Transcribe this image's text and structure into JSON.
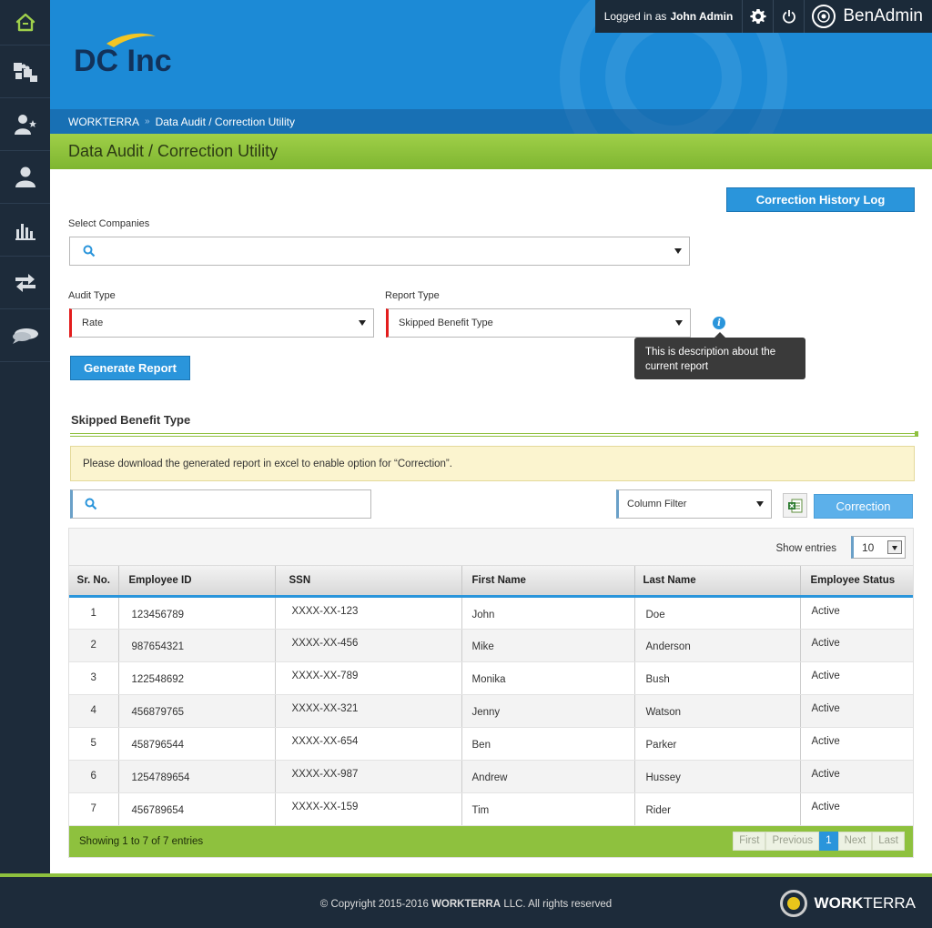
{
  "header": {
    "logo_text": "DC Inc",
    "logged_in_prefix": "Logged in as",
    "user_name": "John Admin",
    "brand": "BenAdmin",
    "breadcrumb": [
      "WORKTERRA",
      "Data Audit / Correction Utility"
    ]
  },
  "page": {
    "title": "Data Audit / Correction Utility"
  },
  "form": {
    "history_button": "Correction History Log",
    "select_companies_label": "Select Companies",
    "select_companies_value": "",
    "audit_type_label": "Audit Type",
    "audit_type_value": "Rate",
    "report_type_label": "Report Type",
    "report_type_value": "Skipped Benefit Type",
    "tooltip": "This is description about the current report",
    "generate_button": "Generate Report"
  },
  "report": {
    "section_title": "Skipped Benefit Type",
    "notice": "Please download the generated report in excel to enable option for “Correction”.",
    "search_value": "",
    "column_filter": "Column Filter",
    "correction_button": "Correction",
    "show_entries_label": "Show entries",
    "entries_value": "10",
    "columns": [
      "Sr. No.",
      "Employee ID",
      "SSN",
      "First Name",
      "Last Name",
      "Employee Status"
    ],
    "rows": [
      [
        "1",
        "123456789",
        "XXXX-XX-123",
        "John",
        "Doe",
        "Active"
      ],
      [
        "2",
        "987654321",
        "XXXX-XX-456",
        "Mike",
        "Anderson",
        "Active"
      ],
      [
        "3",
        "122548692",
        "XXXX-XX-789",
        "Monika",
        "Bush",
        "Active"
      ],
      [
        "4",
        "456879765",
        "XXXX-XX-321",
        "Jenny",
        "Watson",
        "Active"
      ],
      [
        "5",
        "458796544",
        "XXXX-XX-654",
        "Ben",
        "Parker",
        "Active"
      ],
      [
        "6",
        "1254789654",
        "XXXX-XX-987",
        "Andrew",
        "Hussey",
        "Active"
      ],
      [
        "7",
        "456789654",
        "XXXX-XX-159",
        "Tim",
        "Rider",
        "Active"
      ]
    ],
    "footer_info": "Showing 1 to 7 of 7 entries",
    "pager": {
      "first": "First",
      "previous": "Previous",
      "current": "1",
      "next": "Next",
      "last": "Last"
    }
  },
  "footer": {
    "copyright_prefix": "© Copyright 2015-2016",
    "copyright_company": "WORKTERRA",
    "copyright_suffix": "LLC. All rights reserved",
    "brand_bold": "WORK",
    "brand_light": "TERRA"
  },
  "icons": {
    "sidebar": [
      "home-icon",
      "puzzle-icon",
      "user-star-icon",
      "user-icon",
      "bar-chart-icon",
      "transfer-icon",
      "chat-icon"
    ]
  },
  "colors": {
    "accent_blue": "#2a95db",
    "green": "#8ec13e",
    "sidebar": "#1d2b3a",
    "required": "#e31d1d"
  }
}
